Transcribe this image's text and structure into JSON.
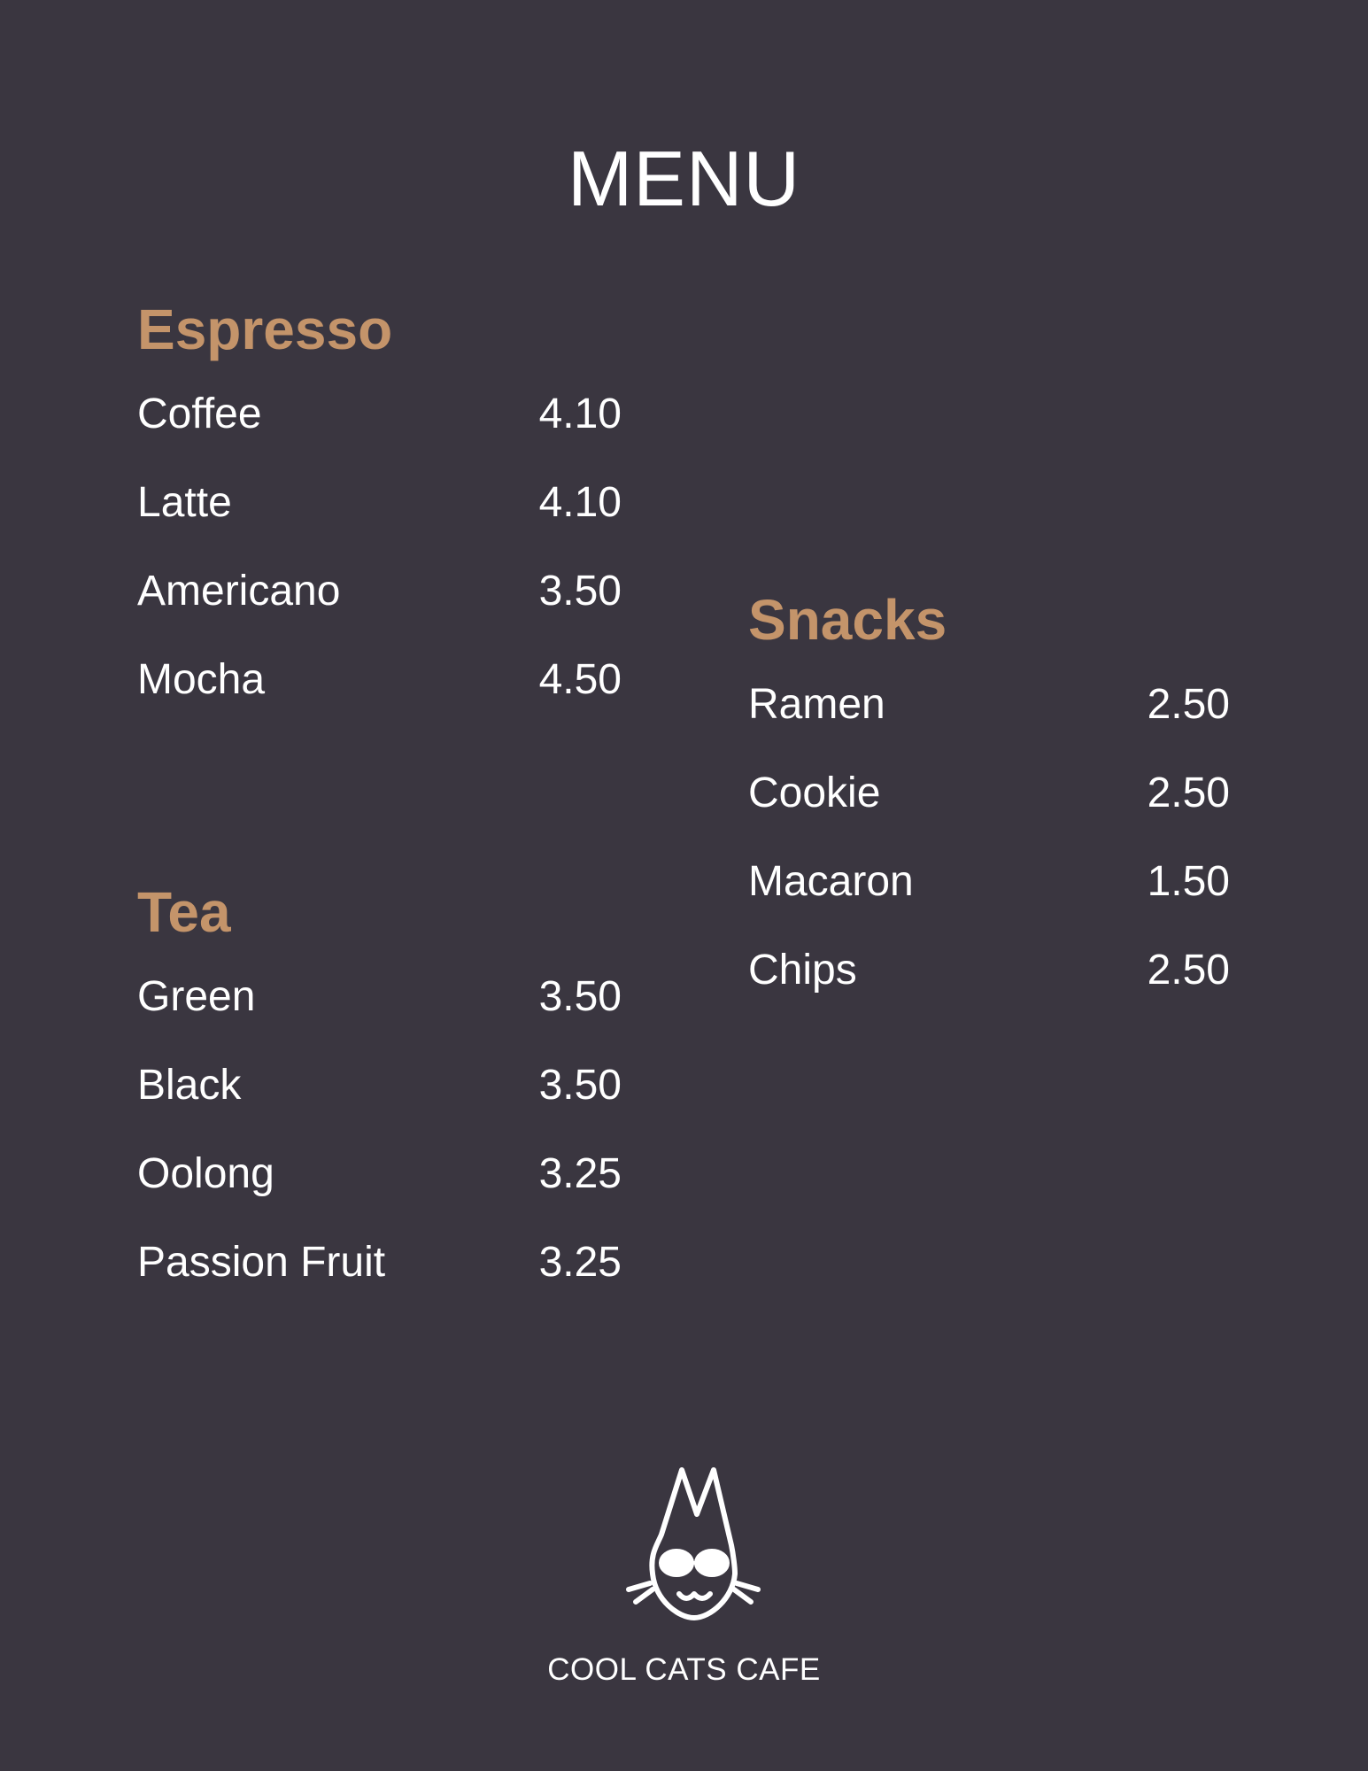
{
  "title": "MENU",
  "accent_color": "#c4946a",
  "background_color": "#3a3640",
  "sections": [
    {
      "heading": "Espresso",
      "items": [
        {
          "name": "Coffee",
          "price": "4.10"
        },
        {
          "name": "Latte",
          "price": "4.10"
        },
        {
          "name": "Americano",
          "price": "3.50"
        },
        {
          "name": "Mocha",
          "price": "4.50"
        }
      ]
    },
    {
      "heading": "Tea",
      "items": [
        {
          "name": "Green",
          "price": "3.50"
        },
        {
          "name": "Black",
          "price": "3.50"
        },
        {
          "name": "Oolong",
          "price": "3.25"
        },
        {
          "name": "Passion Fruit",
          "price": "3.25"
        }
      ]
    },
    {
      "heading": "Snacks",
      "items": [
        {
          "name": "Ramen",
          "price": "2.50"
        },
        {
          "name": "Cookie",
          "price": "2.50"
        },
        {
          "name": "Macaron",
          "price": "1.50"
        },
        {
          "name": "Chips",
          "price": "2.50"
        }
      ]
    }
  ],
  "footer": {
    "logo_icon": "cat-with-sunglasses-icon",
    "brand": "COOL CATS CAFE"
  }
}
